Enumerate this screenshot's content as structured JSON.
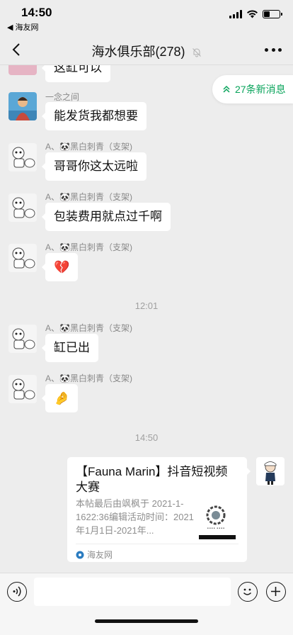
{
  "status_bar": {
    "time": "14:50",
    "back_app": "◀ 海友网"
  },
  "nav": {
    "title": "海水俱乐部(278)"
  },
  "new_messages": {
    "label": "27条新消息"
  },
  "messages": [
    {
      "text": "这缸可以"
    },
    {
      "sender": "一念之间",
      "text": "能发货我都想要"
    },
    {
      "sender": "A、🐼黑白刺青（支架)",
      "text": "哥哥你这太远啦"
    },
    {
      "sender": "A、🐼黑白刺青（支架)",
      "text": "包装费用就点过千啊"
    },
    {
      "sender": "A、🐼黑白刺青（支架)",
      "text": "💔"
    },
    {
      "sender": "A、🐼黑白刺青（支架)",
      "text": "缸已出"
    },
    {
      "sender": "A、🐼黑白刺青（支架)",
      "text": "🤌"
    }
  ],
  "timestamps": [
    "12:01",
    "14:50"
  ],
  "card": {
    "title": "【Fauna Marin】抖音短视频大赛",
    "description": "本帖最后由飒枫于 2021-1-1622:36编辑活动时间：2021年1月1日-2021年...",
    "source": "海友网"
  },
  "icons": {
    "back": "chevron-left-icon",
    "mute": "bell-off-icon",
    "more": "more-icon",
    "voice": "voice-icon",
    "emoji": "emoji-icon",
    "plus": "plus-icon"
  },
  "colors": {
    "background": "#ededed",
    "bubble": "#ffffff",
    "accent": "#07a35a"
  }
}
